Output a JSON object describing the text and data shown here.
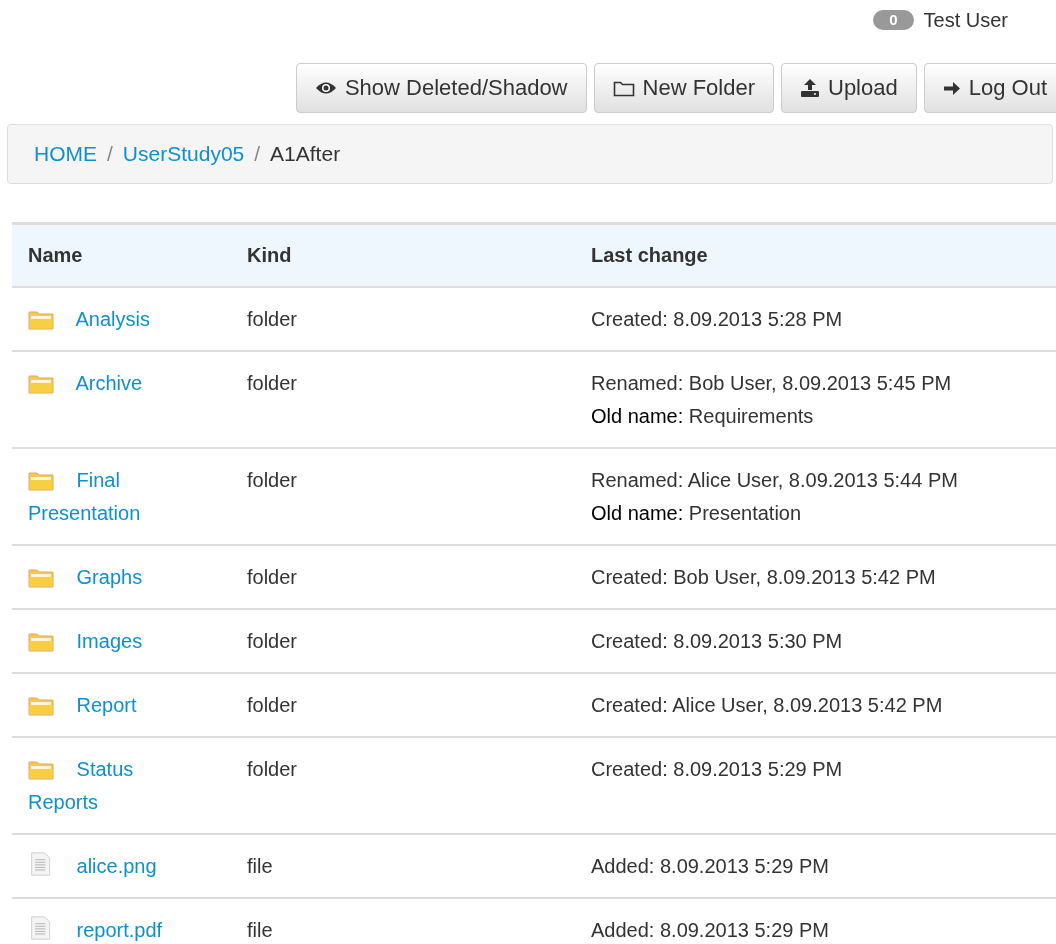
{
  "user": {
    "badge": "0",
    "name": "Test User"
  },
  "toolbar": [
    {
      "kind": "eye",
      "label": "Show Deleted/Shadow"
    },
    {
      "kind": "folder",
      "label": "New Folder"
    },
    {
      "kind": "upload",
      "label": "Upload"
    },
    {
      "kind": "logout",
      "label": "Log Out"
    }
  ],
  "breadcrumb_separator": "/",
  "breadcrumb": [
    {
      "label": "HOME",
      "current": false
    },
    {
      "label": "UserStudy05",
      "current": false
    },
    {
      "label": "A1After",
      "current": true
    }
  ],
  "table": {
    "columns": [
      "Name",
      "Kind",
      "Last change"
    ],
    "rows": [
      {
        "name": "Analysis",
        "kind": "folder",
        "change": "Created: 8.09.2013 5:28 PM"
      },
      {
        "name": "Archive",
        "kind": "folder",
        "change": "Renamed: Bob User, 8.09.2013 5:45 PM",
        "old_name": {
          "label": "Old name:",
          "value": "Requirements"
        }
      },
      {
        "name": "Final Presentation",
        "kind": "folder",
        "change": "Renamed: Alice User, 8.09.2013 5:44 PM",
        "old_name": {
          "label": "Old name:",
          "value": "Presentation"
        }
      },
      {
        "name": "Graphs",
        "kind": "folder",
        "change": "Created: Bob User, 8.09.2013 5:42 PM"
      },
      {
        "name": "Images",
        "kind": "folder",
        "change": "Created: 8.09.2013 5:30 PM"
      },
      {
        "name": "Report",
        "kind": "folder",
        "change": "Created: Alice User, 8.09.2013 5:42 PM"
      },
      {
        "name": "Status Reports",
        "kind": "folder",
        "change": "Created: 8.09.2013 5:29 PM"
      },
      {
        "name": "alice.png",
        "kind": "file",
        "change": "Added: 8.09.2013 5:29 PM"
      },
      {
        "name": "report.pdf",
        "kind": "file",
        "change": "Added: 8.09.2013 5:29 PM"
      }
    ]
  }
}
